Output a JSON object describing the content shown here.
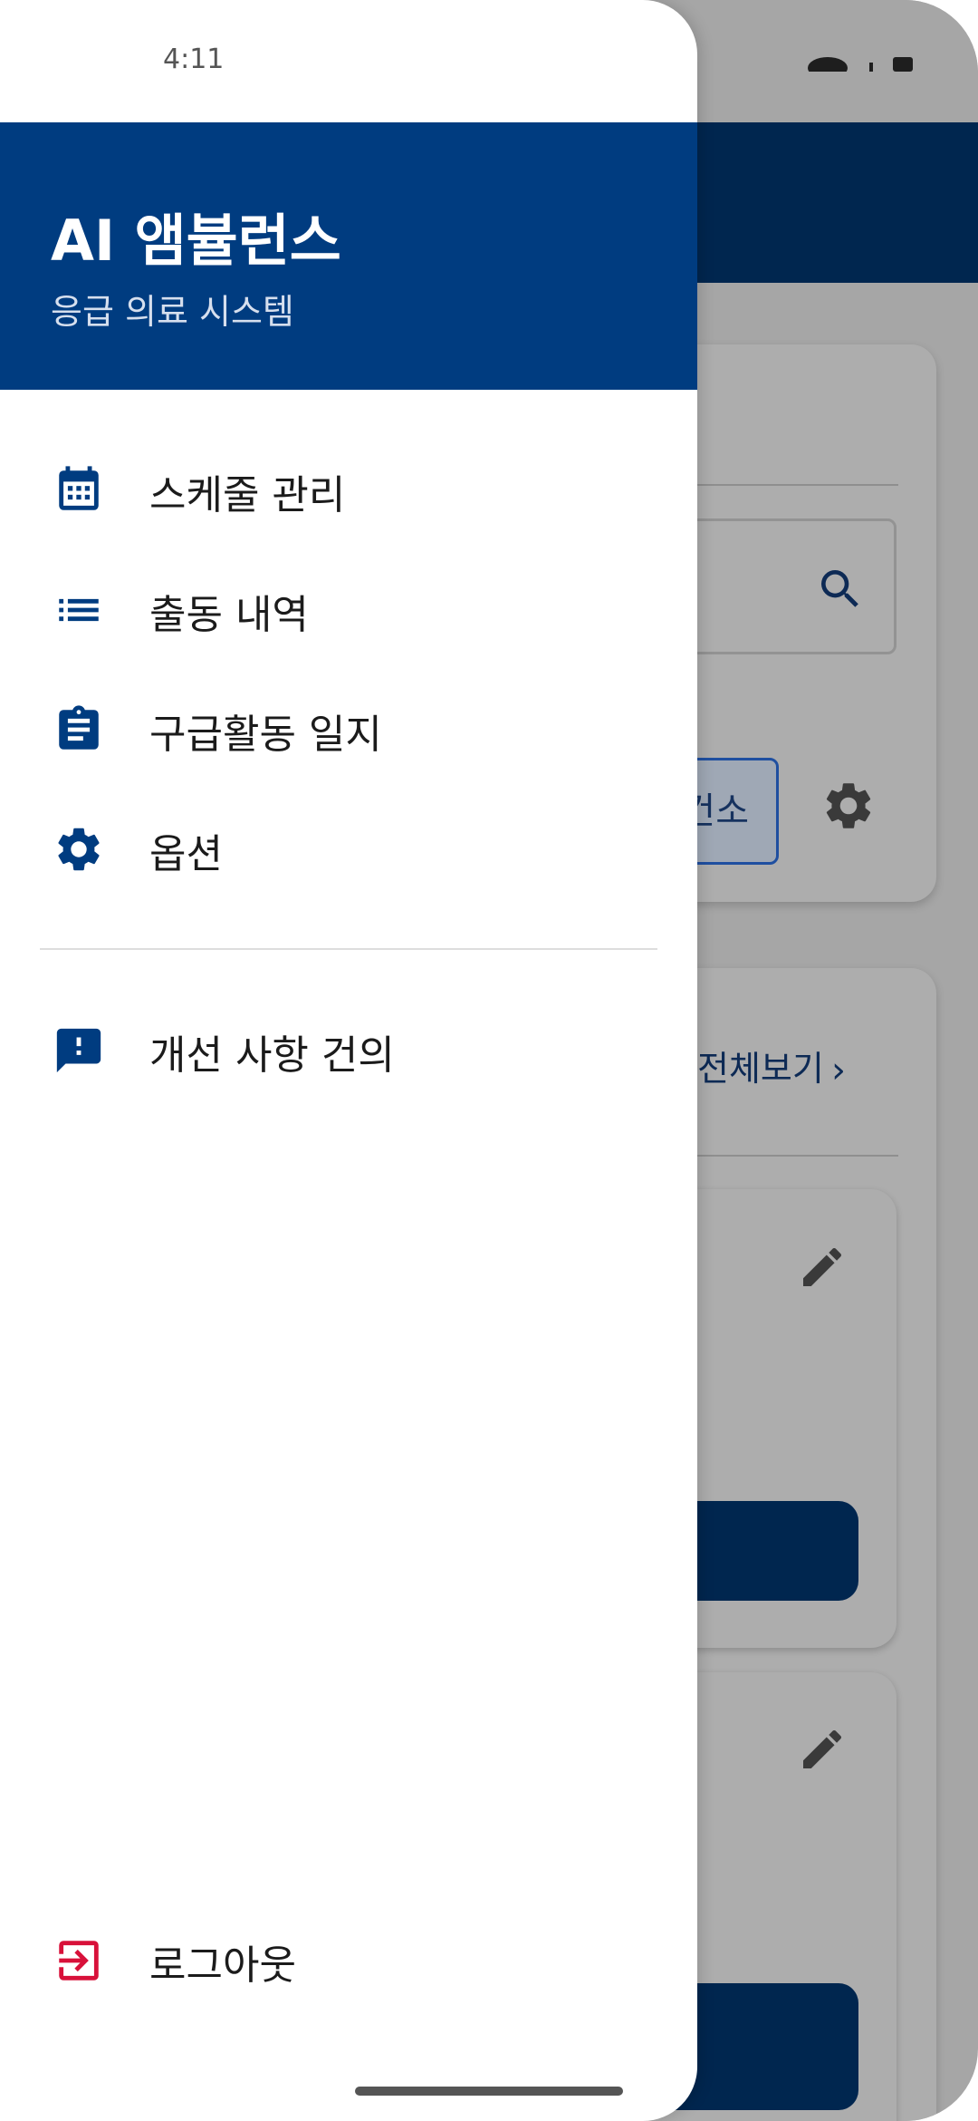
{
  "status_bar": {
    "time": "4:11"
  },
  "drawer": {
    "title": "AI 앰뷸런스",
    "subtitle": "응급 의료 시스템",
    "menu_items": [
      {
        "label": "스케줄 관리",
        "icon": "calendar-icon"
      },
      {
        "label": "출동 내역",
        "icon": "list-icon"
      },
      {
        "label": "구급활동 일지",
        "icon": "clipboard-icon"
      },
      {
        "label": "옵션",
        "icon": "gear-icon"
      }
    ],
    "feedback": {
      "label": "개선 사항 건의",
      "icon": "feedback-icon"
    },
    "logout": {
      "label": "로그아웃",
      "icon": "logout-icon"
    }
  },
  "background": {
    "chip_text": "건소",
    "view_all": "전체보기"
  },
  "colors": {
    "primary": "#003c80",
    "primary_dark": "#00264f",
    "logout_red": "#d8113a",
    "scrim": "#a6a6a6"
  }
}
